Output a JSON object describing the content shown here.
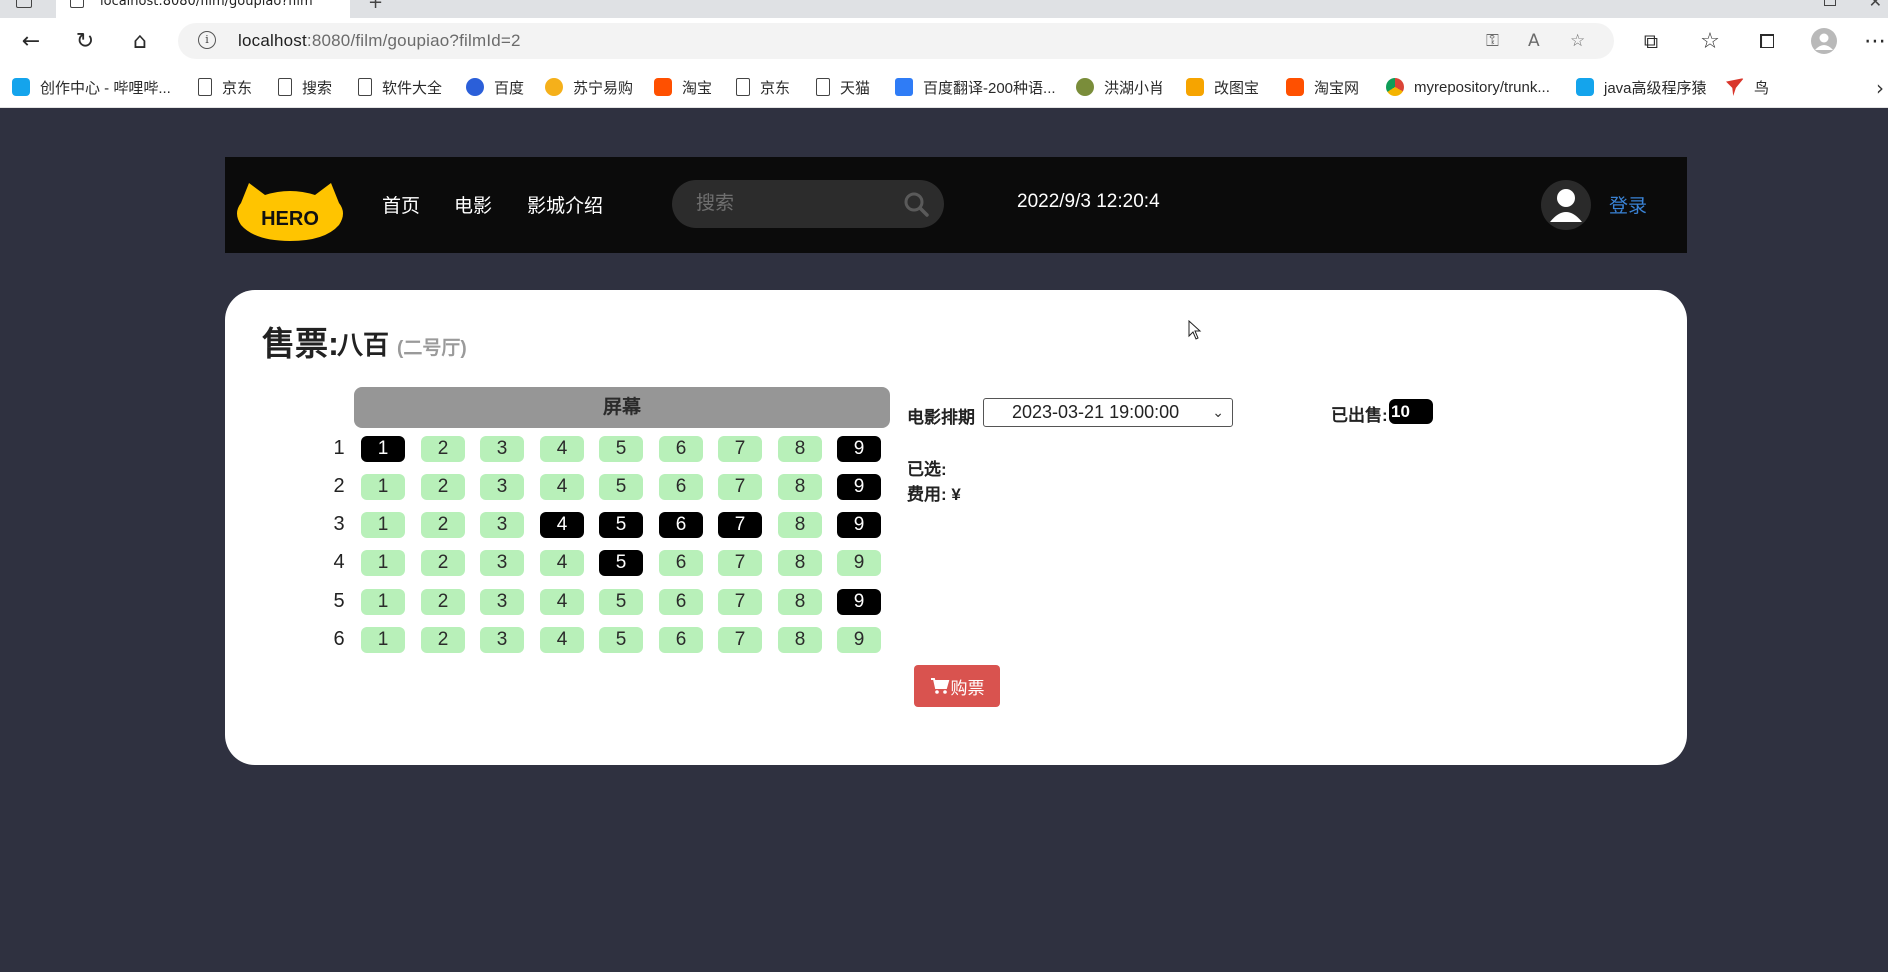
{
  "browser": {
    "tab_title": "localhost:8080/film/goupiao?film",
    "url_host": "localhost",
    "url_rest": ":8080/film/goupiao?filmId=2",
    "bookmarks": [
      {
        "label": "创作中心 - 哔哩哔...",
        "icon": "bilibili-icon"
      },
      {
        "label": "京东",
        "icon": "page-icon"
      },
      {
        "label": "搜索",
        "icon": "page-icon"
      },
      {
        "label": "软件大全",
        "icon": "page-icon"
      },
      {
        "label": "百度",
        "icon": "baidu-icon"
      },
      {
        "label": "苏宁易购",
        "icon": "suning-icon"
      },
      {
        "label": "淘宝",
        "icon": "taobao-icon"
      },
      {
        "label": "京东",
        "icon": "page-icon"
      },
      {
        "label": "天猫",
        "icon": "page-icon"
      },
      {
        "label": "百度翻译-200种语...",
        "icon": "translate-icon"
      },
      {
        "label": "洪湖小肖",
        "icon": "honghu-icon"
      },
      {
        "label": "改图宝",
        "icon": "gaitubao-icon"
      },
      {
        "label": "淘宝网",
        "icon": "taobao-icon"
      },
      {
        "label": "myrepository/trunk...",
        "icon": "chrome-icon"
      },
      {
        "label": "java高级程序猿",
        "icon": "bilibili-icon"
      },
      {
        "label": "鸟",
        "icon": "bird-icon"
      }
    ]
  },
  "header": {
    "logo_text": "HERO",
    "nav": [
      "首页",
      "电影",
      "影城介绍"
    ],
    "search_placeholder": "搜索",
    "datetime": "2022/9/3 12:20:4",
    "login_label": "登录"
  },
  "ticket": {
    "title": "售票:",
    "film_name": "八百",
    "hall": "(二号厅)",
    "screen_label": "屏幕",
    "schedule_label": "电影排期",
    "schedule_value": "2023-03-21 19:00:00",
    "sold_label": "已出售:",
    "sold_count": "10",
    "selected_label": "已选:",
    "cost_label": "费用: ¥",
    "buy_label": "购票",
    "rows": [
      {
        "row": "1",
        "seats": [
          "1",
          "2",
          "3",
          "4",
          "5",
          "6",
          "7",
          "8",
          "9"
        ],
        "sold": [
          1,
          9
        ]
      },
      {
        "row": "2",
        "seats": [
          "1",
          "2",
          "3",
          "4",
          "5",
          "6",
          "7",
          "8",
          "9"
        ],
        "sold": [
          9
        ]
      },
      {
        "row": "3",
        "seats": [
          "1",
          "2",
          "3",
          "4",
          "5",
          "6",
          "7",
          "8",
          "9"
        ],
        "sold": [
          4,
          5,
          6,
          7,
          9
        ]
      },
      {
        "row": "4",
        "seats": [
          "1",
          "2",
          "3",
          "4",
          "5",
          "6",
          "7",
          "8",
          "9"
        ],
        "sold": [
          5
        ]
      },
      {
        "row": "5",
        "seats": [
          "1",
          "2",
          "3",
          "4",
          "5",
          "6",
          "7",
          "8",
          "9"
        ],
        "sold": [
          9
        ]
      },
      {
        "row": "6",
        "seats": [
          "1",
          "2",
          "3",
          "4",
          "5",
          "6",
          "7",
          "8",
          "9"
        ],
        "sold": []
      }
    ]
  },
  "colors": {
    "page_bg": "#2f3140",
    "seat_available": "#b8f0b9",
    "seat_sold": "#000000",
    "buy_button": "#d9534f",
    "login_link": "#3a83d6",
    "logo_yellow": "#ffc400"
  }
}
